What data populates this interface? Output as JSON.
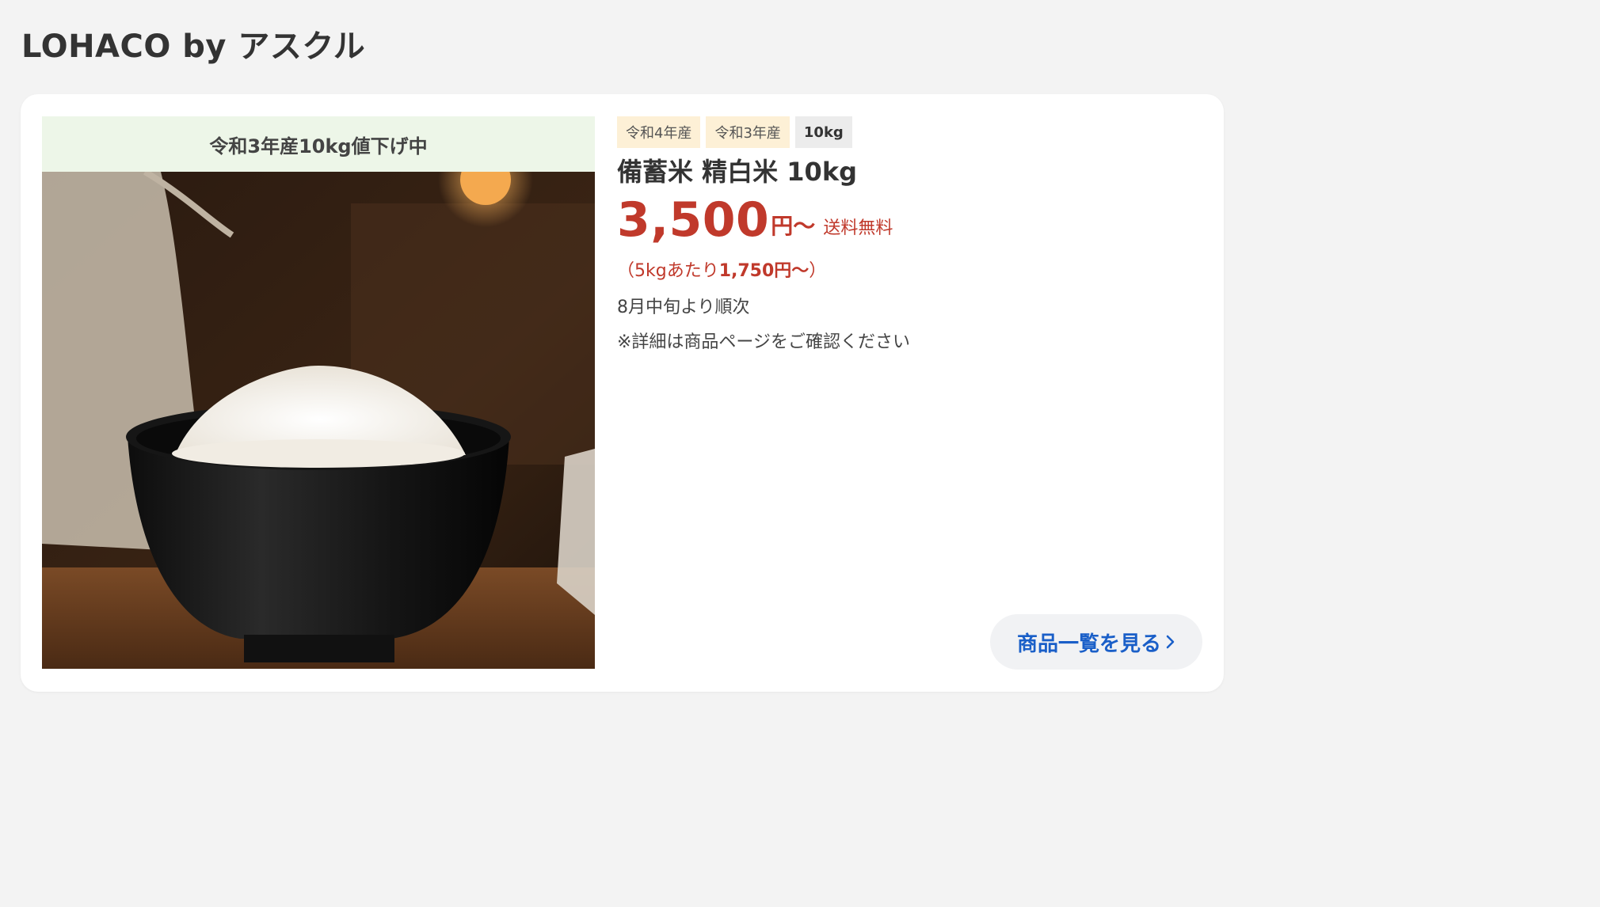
{
  "header": {
    "title": "LOHACO by アスクル"
  },
  "card": {
    "promo_band": "令和3年産10kg値下げ中",
    "tags": [
      "令和4年産",
      "令和3年産",
      "10kg"
    ],
    "product_name": "備蓄米 精白米 10kg",
    "price": {
      "amount": "3,500",
      "unit": "円〜",
      "shipping": "送料無料"
    },
    "per_kg": {
      "prefix": "（5kgあたり",
      "amount": "1,750円〜",
      "suffix": "）"
    },
    "ship_note": "8月中旬より順次",
    "detail_note": "※詳細は商品ページをご確認ください",
    "more_button": "商品一覧を見る"
  },
  "colors": {
    "price_red": "#c0392b",
    "link_blue": "#1a5fc8",
    "promo_bg": "#edf6e8",
    "tag_bg": "#fdf0d6"
  },
  "icons": {
    "more_button": "chevron-right-icon"
  }
}
